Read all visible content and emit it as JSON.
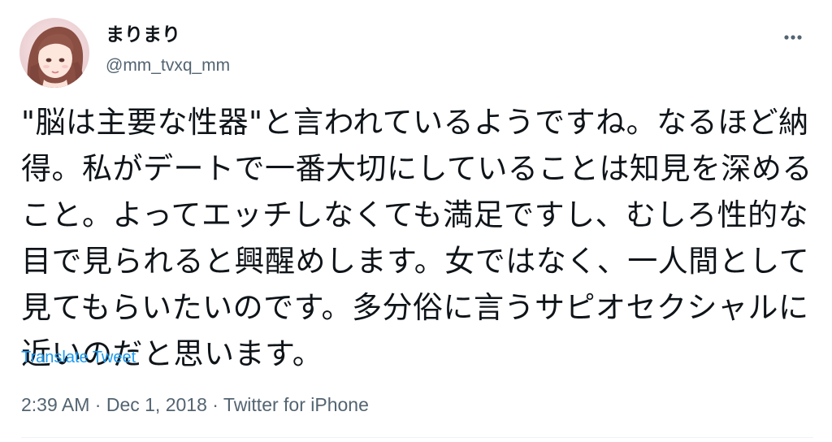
{
  "user": {
    "display_name": "まりまり",
    "handle": "@mm_tvxq_mm"
  },
  "tweet": {
    "text": "\"脳は主要な性器\"と言われているようですね。なるほど納得。私がデートで一番大切にしていることは知見を深めること。よってエッチしなくても満足ですし、むしろ性的な目で見られると興醒めします。女ではなく、一人間として見てもらいたいのです。多分俗に言うサピオセクシャルに近いのだと思います。",
    "translate_label": "Translate Tweet",
    "time": "2:39 AM",
    "date": "Dec 1, 2018",
    "separator": "·",
    "source": "Twitter for iPhone"
  },
  "icons": {
    "more": "more-horizontal-icon",
    "avatar": "user-avatar"
  },
  "colors": {
    "text": "#0f1419",
    "secondary": "#536471",
    "link": "#1d9bf0"
  }
}
